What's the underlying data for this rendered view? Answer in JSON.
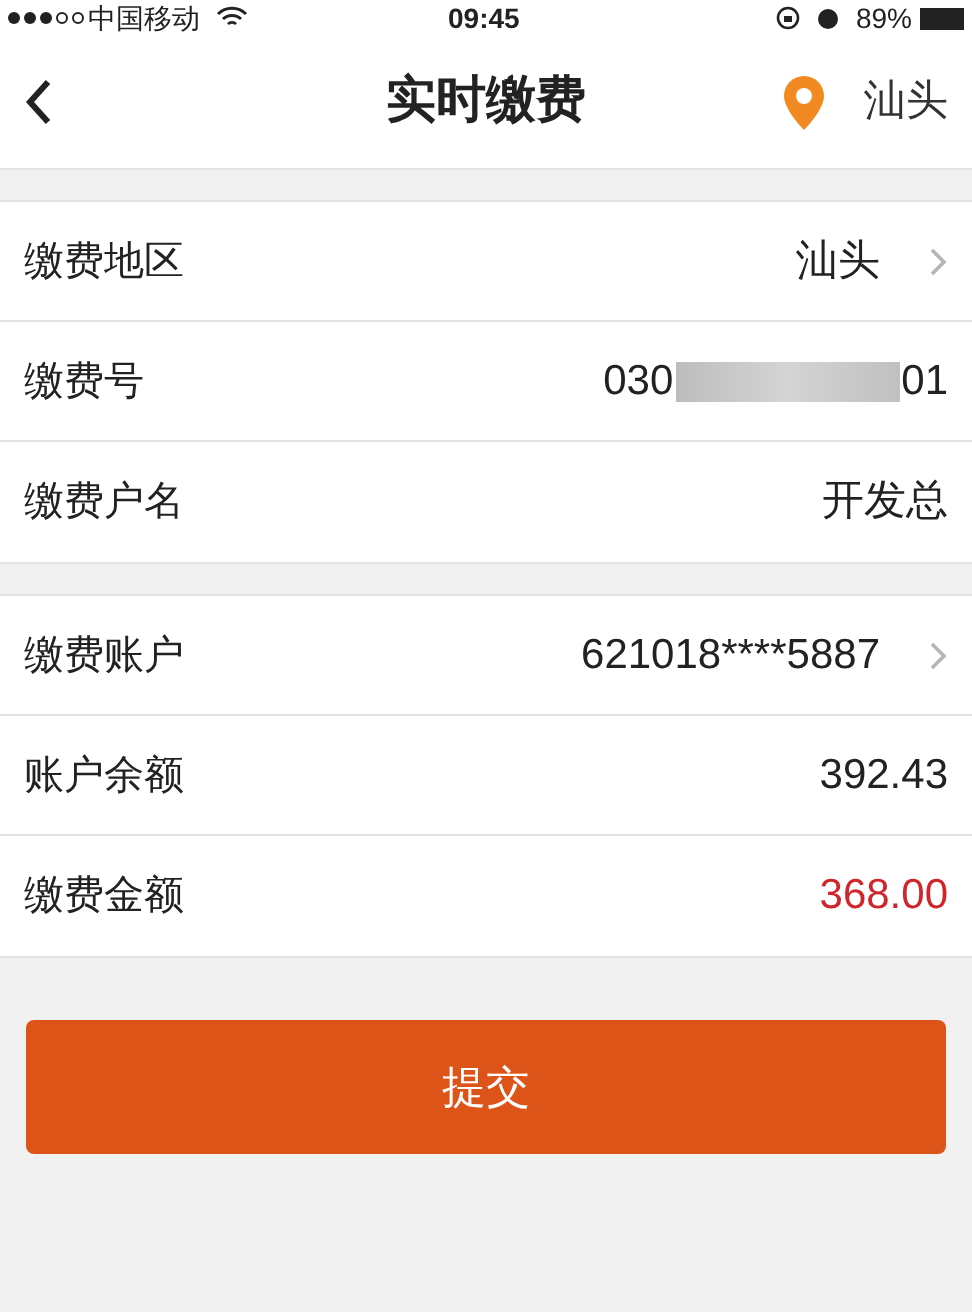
{
  "status_bar": {
    "carrier": "中国移动",
    "time": "09:45",
    "battery": "89%"
  },
  "nav": {
    "title": "实时缴费",
    "location": "汕头"
  },
  "sections": [
    {
      "rows": [
        {
          "kind": "plain",
          "label": "缴费地区",
          "value": "汕头",
          "chevron": true,
          "highlight": false
        },
        {
          "kind": "masked",
          "label": "缴费号",
          "prefix": "030",
          "suffix": "01",
          "chevron": false,
          "highlight": false
        },
        {
          "kind": "plain",
          "label": "缴费户名",
          "value": "开发总",
          "chevron": false,
          "highlight": false
        }
      ]
    },
    {
      "rows": [
        {
          "kind": "plain",
          "label": "缴费账户",
          "value": "621018****5887",
          "chevron": true,
          "highlight": false
        },
        {
          "kind": "plain",
          "label": "账户余额",
          "value": "392.43",
          "chevron": false,
          "highlight": false
        },
        {
          "kind": "plain",
          "label": "缴费金额",
          "value": "368.00",
          "chevron": false,
          "highlight": true
        }
      ]
    }
  ],
  "submit": "提交"
}
